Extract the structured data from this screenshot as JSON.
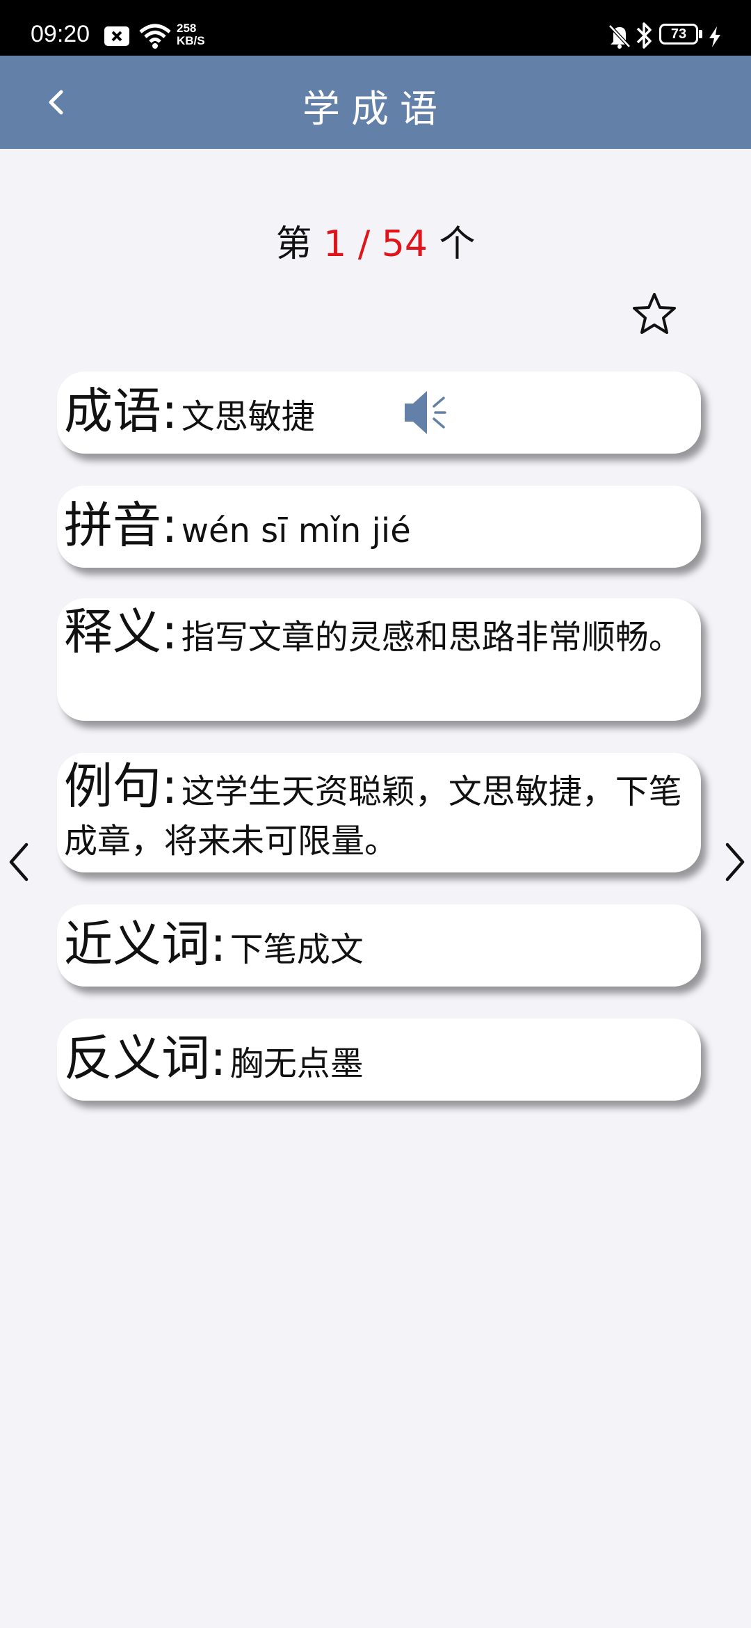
{
  "status_bar": {
    "time": "09:20",
    "net_speed_value": "258",
    "net_speed_unit": "KB/S",
    "battery": "73",
    "icons": [
      "notification-icon",
      "wifi-icon",
      "mute-icon",
      "bluetooth-icon",
      "battery-icon",
      "charging-icon"
    ]
  },
  "header": {
    "title": "学成语"
  },
  "counter": {
    "prefix": "第",
    "current": "1",
    "sep": "/",
    "total": "54",
    "suffix": "个"
  },
  "cards": {
    "idiom": {
      "label": "成语",
      "colon": ":",
      "value": "文思敏捷"
    },
    "pinyin": {
      "label": "拼音",
      "colon": ":",
      "value": "wén sī mǐn jié"
    },
    "meaning": {
      "label": "释义",
      "colon": ":",
      "value": "指写文章的灵感和思路非常顺畅。"
    },
    "example": {
      "label": "例句",
      "colon": ":",
      "value": "这学生天资聪颖，文思敏捷，下笔成章，将来未可限量。"
    },
    "synonym": {
      "label": "近义词",
      "colon": ":",
      "value": "下笔成文"
    },
    "antonym": {
      "label": "反义词",
      "colon": ":",
      "value": "胸无点墨"
    }
  },
  "colors": {
    "app_bar": "#6380a9",
    "accent_red": "#e0141b",
    "background": "#f3f3f8",
    "speaker": "#6380a9"
  }
}
